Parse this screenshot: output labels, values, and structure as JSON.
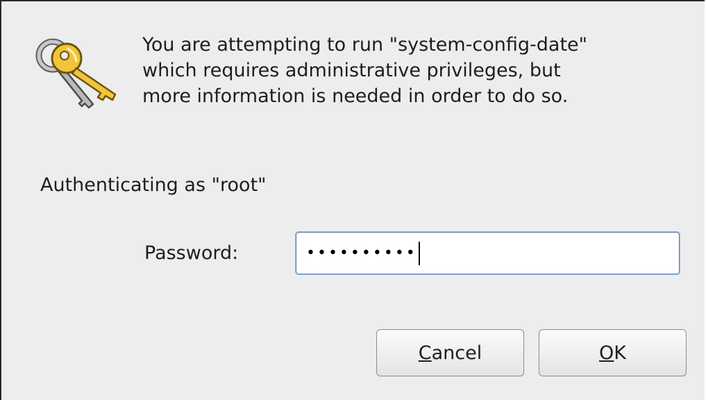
{
  "dialog": {
    "icon": "keys-icon",
    "message": "You are attempting to run \"system-config-date\"\nwhich requires administrative privileges, but\nmore information is needed in order to do so.",
    "auth_label": "Authenticating as \"root\"",
    "password_label": "Password:",
    "password_value": "••••••••••",
    "buttons": {
      "cancel_mnemonic": "C",
      "cancel_rest": "ancel",
      "ok_mnemonic": "O",
      "ok_rest": "K"
    }
  }
}
